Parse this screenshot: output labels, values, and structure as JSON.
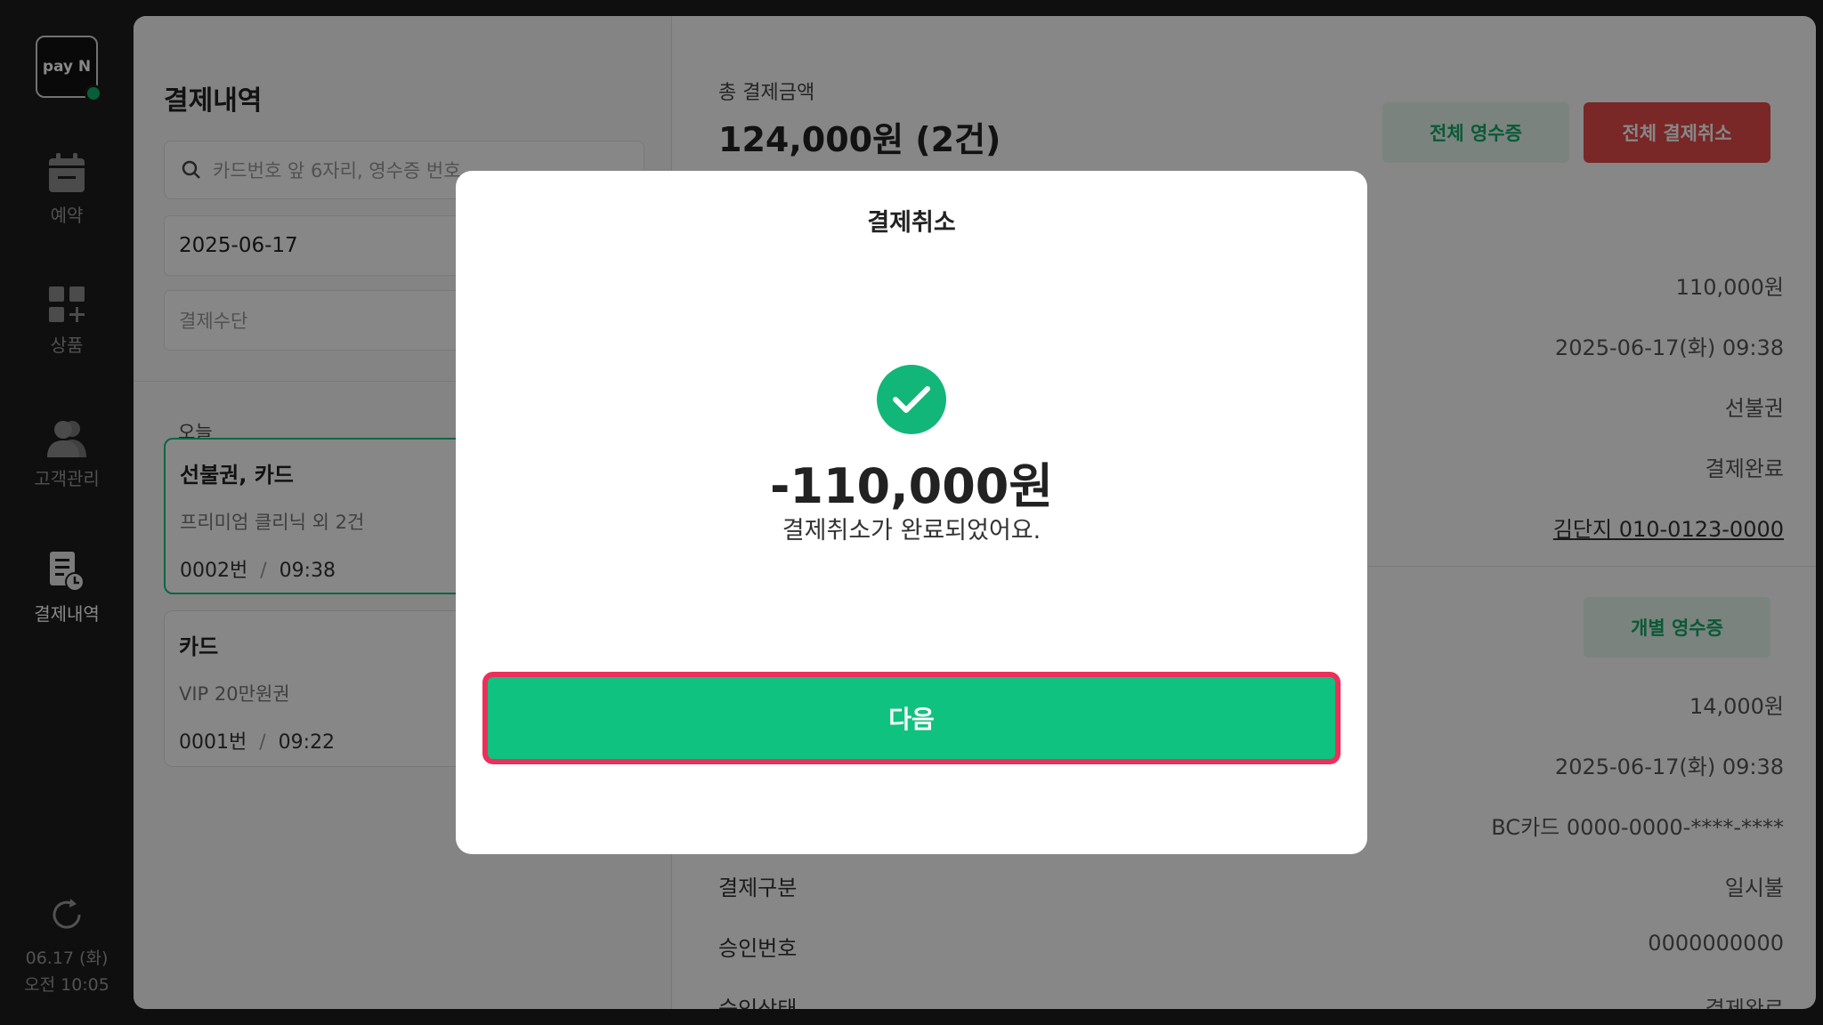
{
  "sidebar": {
    "logo": "pay N",
    "items": [
      {
        "label": "예약",
        "icon": "calendar-icon"
      },
      {
        "label": "상품",
        "icon": "grid-plus-icon"
      },
      {
        "label": "고객관리",
        "icon": "users-icon"
      },
      {
        "label": "결제내역",
        "icon": "receipt-clock-icon",
        "active": true
      }
    ],
    "date": "06.17 (화)",
    "time": "오전 10:05"
  },
  "list": {
    "title": "결제내역",
    "search_placeholder": "카드번호 앞 6자리, 영수증 번호",
    "date_filter": "2025-06-17",
    "method_filter": "결제수단",
    "section": "오늘",
    "cards": [
      {
        "title": "선불권, 카드",
        "subtitle": "프리미엄 클리닉 외 2건",
        "number": "0002번",
        "time": "09:38",
        "selected": true
      },
      {
        "title": "카드",
        "subtitle": "VIP 20만원권",
        "number": "0001번",
        "time": "09:22",
        "selected": false
      }
    ]
  },
  "detail": {
    "total_label": "총 결제금액",
    "total_value": "124,000원 (2건)",
    "receipt_all": "전체 영수증",
    "cancel_all": "전체 결제취소",
    "group1": [
      "110,000원",
      "2025-06-17(화) 09:38",
      "선불권",
      "결제완료",
      "김단지 010-0123-0000"
    ],
    "receipt_single": "개별 영수증",
    "group2": [
      "14,000원",
      "2025-06-17(화) 09:38",
      "BC카드 0000-0000-****-****"
    ],
    "rows": [
      {
        "label": "결제구분",
        "value": "일시불"
      },
      {
        "label": "승인번호",
        "value": "0000000000"
      },
      {
        "label": "승인상태",
        "value": "결제완료"
      }
    ]
  },
  "modal": {
    "title": "결제취소",
    "amount": "-110,000원",
    "message": "결제취소가 완료되었어요.",
    "next_button": "다음"
  },
  "colors": {
    "accent": "#10c27f",
    "danger": "#e44a4a",
    "highlight": "#ec2f5b"
  }
}
